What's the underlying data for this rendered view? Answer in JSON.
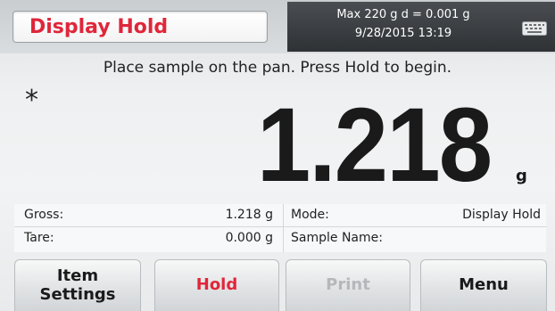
{
  "header": {
    "mode_title": "Display Hold",
    "capacity_readability": "Max 220 g  d = 0.001 g",
    "datetime": "9/28/2015  13:19",
    "keyboard_icon": "keyboard-icon"
  },
  "main": {
    "instruction": "Place sample on the pan. Press Hold to begin.",
    "stability_indicator": "*",
    "weight_value": "1.218",
    "weight_unit": "g"
  },
  "info": {
    "gross_label": "Gross:",
    "gross_value": "1.218 g",
    "tare_label": "Tare:",
    "tare_value": "0.000 g",
    "mode_label": "Mode:",
    "mode_value": "Display Hold",
    "sample_name_label": "Sample Name:",
    "sample_name_value": ""
  },
  "buttons": {
    "item_settings_line1": "Item",
    "item_settings_line2": "Settings",
    "hold": "Hold",
    "print": "Print",
    "menu": "Menu"
  },
  "colors": {
    "accent_red": "#e0263a",
    "header_dark": "#2f3235",
    "disabled_text": "#b5b8bb"
  }
}
